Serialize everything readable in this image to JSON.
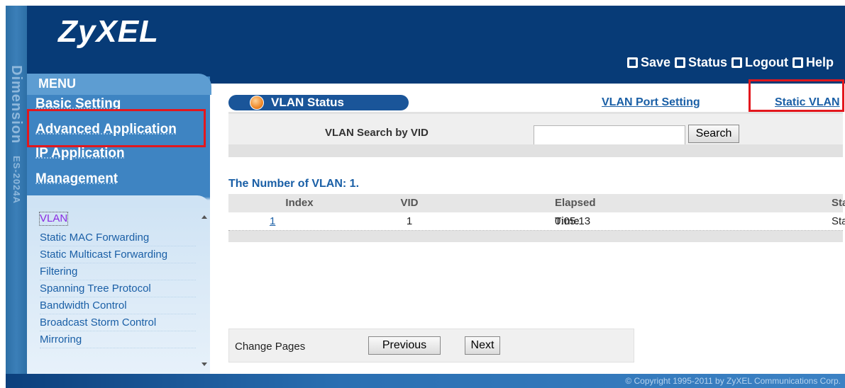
{
  "header": {
    "logo": "ZyXEL",
    "links": [
      {
        "label": "Save",
        "icon": "save-icon"
      },
      {
        "label": "Status",
        "icon": "status-icon"
      },
      {
        "label": "Logout",
        "icon": "logout-icon"
      },
      {
        "label": "Help",
        "icon": "help-icon"
      }
    ]
  },
  "side_strip": {
    "brand": "Dimension",
    "model": "ES-2024A"
  },
  "menu": {
    "header": "MENU",
    "items": [
      "Basic Setting",
      "Advanced Application",
      "IP Application",
      "Management"
    ],
    "submenu": [
      "VLAN",
      "Static MAC Forwarding",
      "Static Multicast Forwarding",
      "Filtering",
      "Spanning Tree Protocol",
      "Bandwidth Control",
      "Broadcast Storm Control",
      "Mirroring"
    ]
  },
  "content": {
    "tab_title": "VLAN Status",
    "link_port": "VLAN Port Setting",
    "link_static": "Static VLAN",
    "search_label": "VLAN Search by VID",
    "search_value": "",
    "search_button": "Search",
    "num_vlan": "The Number of VLAN: 1.",
    "table": {
      "columns": [
        "Index",
        "VID",
        "Elapsed Time",
        "Status"
      ],
      "rows": [
        {
          "index": "1",
          "vid": "1",
          "elapsed": "0:05:13",
          "status": "Static"
        }
      ]
    },
    "pager": {
      "label": "Change Pages",
      "prev": "Previous",
      "next": "Next"
    }
  },
  "footer": {
    "copyright": "© Copyright 1995-2011 by ZyXEL Communications Corp."
  },
  "colors": {
    "header_bg": "#073b77",
    "menu_bg": "#3e84c2",
    "highlight": "#e3171d",
    "link": "#1a5fa6"
  }
}
